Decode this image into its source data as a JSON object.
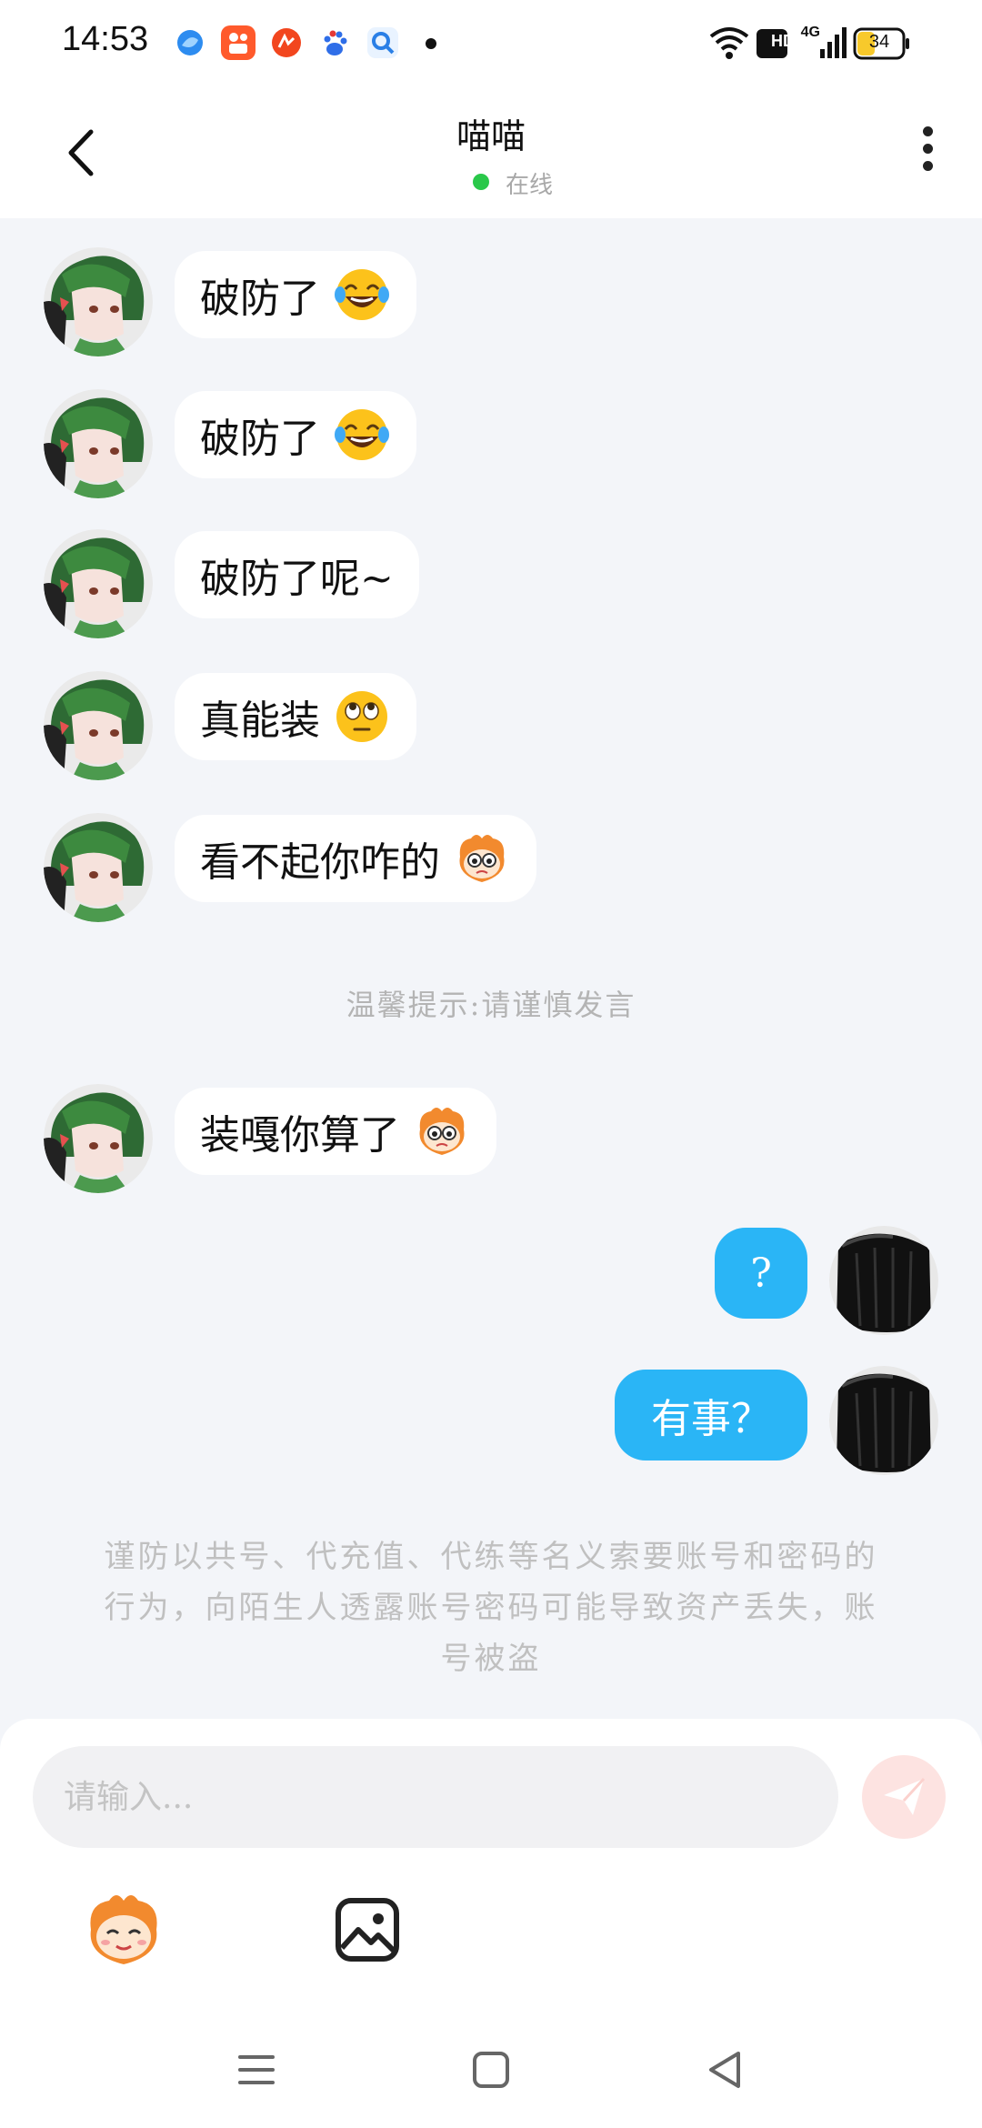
{
  "status_bar": {
    "time": "14:53",
    "network_label": "4G",
    "hd_label": "HD",
    "battery_level": "34",
    "app_icons": [
      "blue-bird-icon",
      "kuaishou-icon",
      "orange-app-icon",
      "baidu-paw-icon",
      "search-app-icon"
    ]
  },
  "header": {
    "title": "喵喵",
    "status_text": "在线",
    "status_color": "#2ac84a"
  },
  "messages": [
    {
      "direction": "in",
      "text": "破防了",
      "emoji": "tears-of-joy-emoji"
    },
    {
      "direction": "in",
      "text": "破防了",
      "emoji": "tears-of-joy-emoji"
    },
    {
      "direction": "in",
      "text": "破防了呢~",
      "emoji": ""
    },
    {
      "direction": "in",
      "text": "真能装",
      "emoji": "eye-roll-emoji"
    },
    {
      "direction": "in",
      "text": "看不起你咋的",
      "emoji": "cartoon-monkey-sticker"
    },
    {
      "direction": "in",
      "text": "装嘎你算了",
      "emoji": "cartoon-monkey-sticker"
    },
    {
      "direction": "out",
      "text": "?",
      "emoji": ""
    },
    {
      "direction": "out",
      "text": "有事？",
      "emoji": ""
    }
  ],
  "system_tip": "温馨提示:请谨慎发言",
  "security_warning": "谨防以共号、代充值、代练等名义索要账号和密码的行为，向陌生人透露账号密码可能导致资产丢失，账号被盗",
  "composer": {
    "placeholder": "请输入...",
    "send_button_color": "#fde3e1"
  },
  "colors": {
    "outgoing_bubble": "#2ab5f6",
    "incoming_bubble": "#ffffff",
    "background": "#f3f5f9"
  }
}
